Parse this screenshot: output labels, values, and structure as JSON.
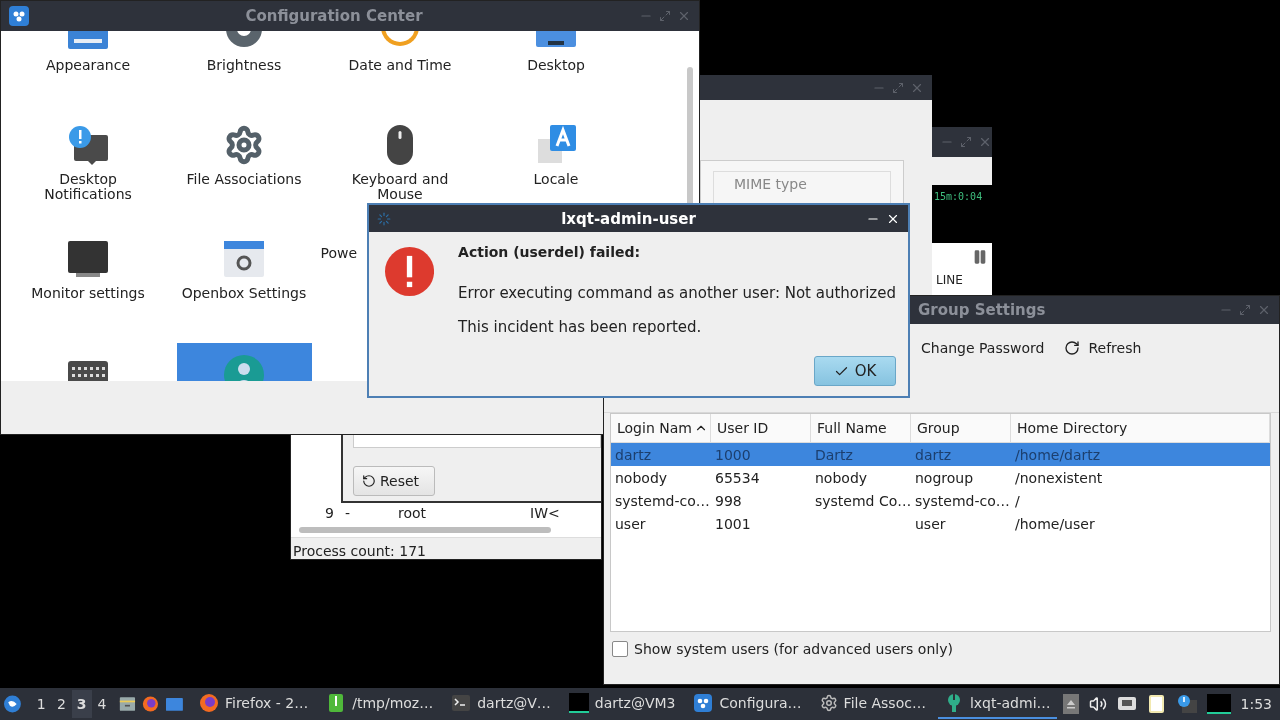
{
  "config_center": {
    "title": "Configuration Center",
    "rows": [
      [
        {
          "label": "Appearance",
          "selected": false
        },
        {
          "label": "Brightness",
          "selected": false
        },
        {
          "label": "Date and Time",
          "selected": false
        },
        {
          "label": "Desktop",
          "selected": false
        }
      ],
      [
        {
          "label": "Desktop Notifications",
          "selected": false
        },
        {
          "label": "File Associations",
          "selected": false
        },
        {
          "label": "Keyboard and Mouse",
          "selected": false
        },
        {
          "label": "Locale",
          "selected": false
        }
      ],
      [
        {
          "label": "Monitor settings",
          "selected": false
        },
        {
          "label": "Openbox Settings",
          "selected": false
        },
        {
          "label": "Powe",
          "selected": false,
          "kind": "cut"
        }
      ],
      [
        {
          "selected": false
        },
        {
          "selected": true
        }
      ]
    ]
  },
  "file_associations": {
    "column": "MIME type"
  },
  "terminal": {
    "clock": "15m:0:04",
    "label": "LINE"
  },
  "process_window": {
    "reset": "Reset",
    "row": [
      "9",
      "-",
      "root",
      "IW<"
    ],
    "status": "Process count: 171"
  },
  "users_window": {
    "title": "Group Settings",
    "toolbar": [
      "Change Password",
      "Refresh"
    ],
    "columns": [
      "Login Nam",
      "User ID",
      "Full Name",
      "Group",
      "Home Directory"
    ],
    "rows": [
      {
        "cells": [
          "dartz",
          "1000",
          "Dartz",
          "dartz",
          "/home/dartz"
        ],
        "selected": true
      },
      {
        "cells": [
          "nobody",
          "65534",
          "nobody",
          "nogroup",
          "/nonexistent"
        ],
        "selected": false
      },
      {
        "cells": [
          "systemd-co…",
          "998",
          "systemd Co…",
          "systemd-co…",
          "/"
        ],
        "selected": false
      },
      {
        "cells": [
          "user",
          "1001",
          "",
          "user",
          "/home/user"
        ],
        "selected": false
      }
    ],
    "show_system_users": {
      "label": "Show system users (for advanced users only)",
      "checked": false
    }
  },
  "dialog": {
    "title": "lxqt-admin-user",
    "heading": "Action (userdel) failed:",
    "message": "Error executing command as another user: Not authorized",
    "note": "This incident has been reported.",
    "button": "OK"
  },
  "taskbar": {
    "desktops": [
      {
        "label": "1",
        "selected": false
      },
      {
        "label": "2",
        "selected": false
      },
      {
        "label": "3",
        "selected": true
      },
      {
        "label": "4",
        "selected": false
      }
    ],
    "tasks": [
      {
        "label": "Firefox - 2…",
        "active": false
      },
      {
        "label": "/tmp/moz…",
        "active": false
      },
      {
        "label": "dartz@V…",
        "active": false
      },
      {
        "label": "dartz@VM3",
        "active": false
      },
      {
        "label": "Configura…",
        "active": false
      },
      {
        "label": "File Assoc…",
        "active": false
      },
      {
        "label": "lxqt-admi…",
        "active": true
      }
    ],
    "clock": "1:53"
  }
}
